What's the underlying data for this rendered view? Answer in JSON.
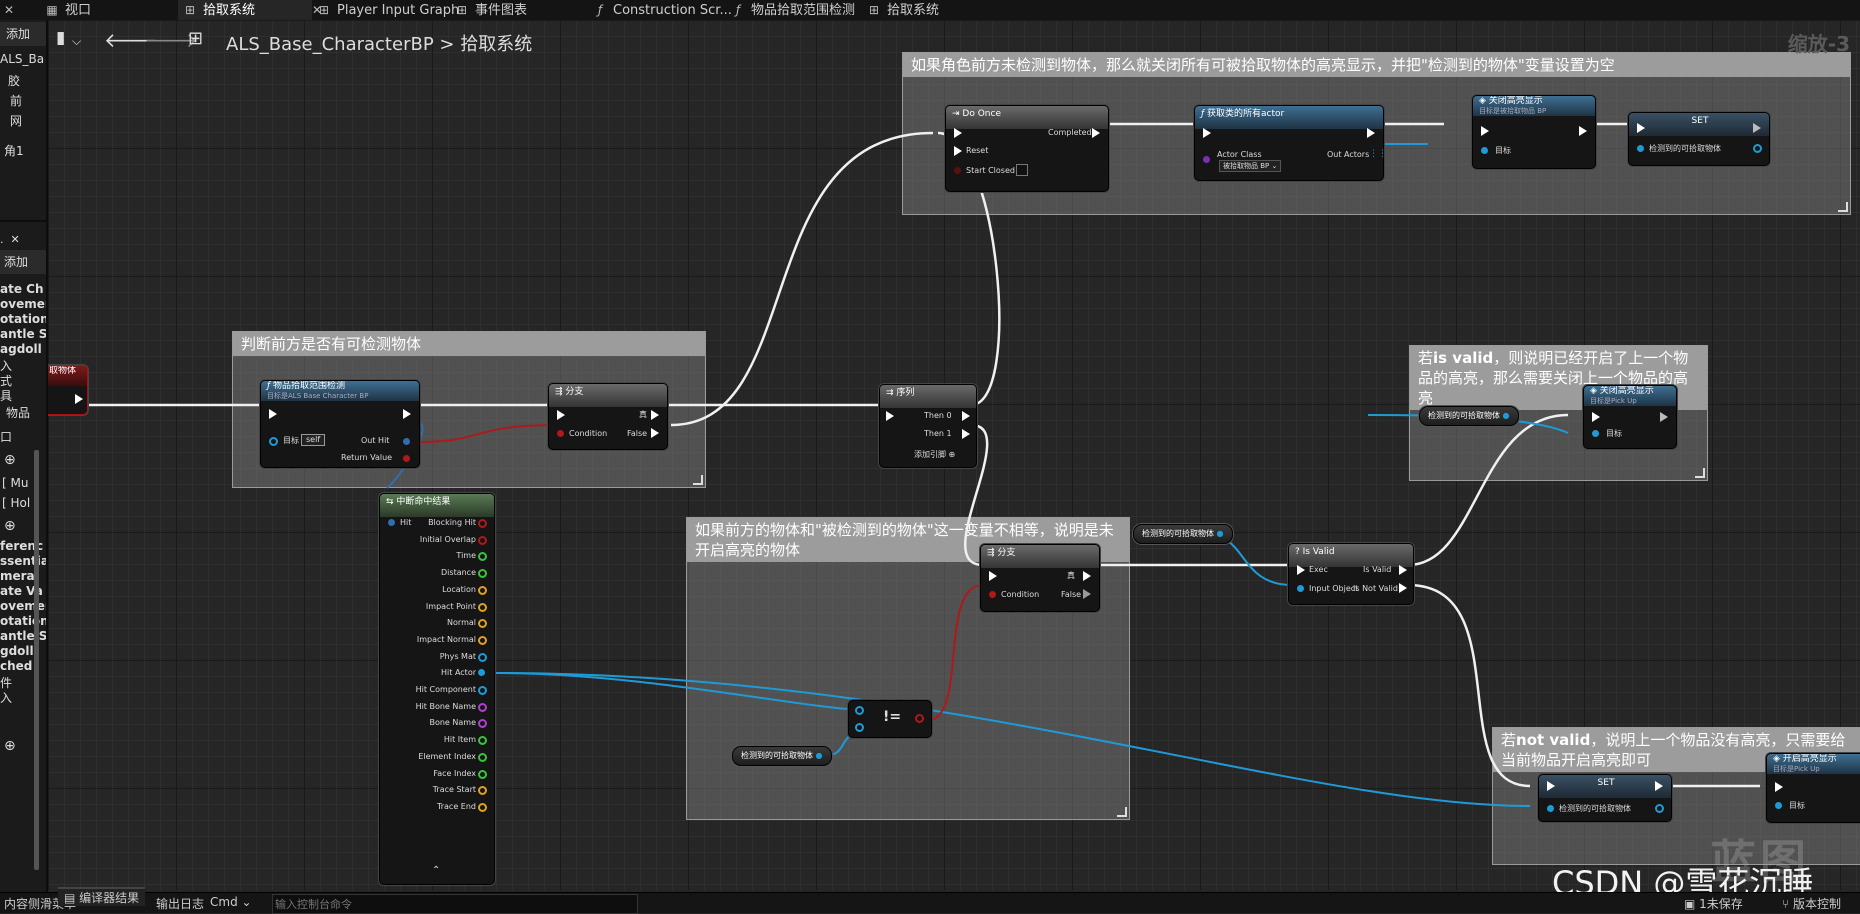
{
  "tabs": [
    {
      "label": "视口",
      "icon": "viewport-grid-icon"
    },
    {
      "label": "拾取系统",
      "icon": "graph-icon",
      "active": true
    },
    {
      "label": "Player Input Graph",
      "icon": "graph-icon"
    },
    {
      "label": "事件图表",
      "icon": "graph-icon"
    },
    {
      "label": "Construction Scr...",
      "icon": "function-icon"
    },
    {
      "label": "物品拾取范围检测",
      "icon": "function-icon"
    },
    {
      "label": "拾取系统",
      "icon": "graph-icon"
    }
  ],
  "left_panel": {
    "add_label_top": "添加",
    "add_label_mid": "添加",
    "items_top": [
      "ALS_Ba",
      "胶",
      "前",
      "网",
      "角1"
    ],
    "items_mid": [
      "取物体",
      "ate Ch",
      "ovemen",
      "otation",
      "antle S",
      "agdoll",
      "入",
      "式",
      "具",
      "物品"
    ],
    "items_low": [
      "口",
      "Mu",
      "Hol",
      "ferenc",
      "ssentia",
      "mera",
      "ate Va",
      "ovemen",
      "otation",
      "antle S",
      "gdoll",
      "ched",
      "件",
      "入"
    ]
  },
  "toolbar": {
    "blueprint": "ALS_Base_CharacterBP",
    "separator": ">",
    "graph": "拾取系统",
    "zoom": "缩放-3"
  },
  "comments": {
    "c1": "如果角色前方未检测到物体，那么就关闭所有可被拾取物体的高亮显示，并把\"检测到的物体\"变量设置为空",
    "c2": "判断前方是否有可检测物体",
    "c3": "如果前方的物体和\"被检测到的物体\"这一变量不相等，说明是未开启高亮的物体",
    "c4a": "若",
    "c4b": "is valid",
    "c4c": "，则说明已经开启了上一个物品的高亮，那么需要关闭上一个物品的高亮",
    "c5a": "若",
    "c5b": "not valid",
    "c5c": "，说明上一个物品没有高亮，只需要给当前物品开启高亮即可"
  },
  "nodes": {
    "event_partial": "取物体",
    "pickup_func": {
      "title": "物品拾取范围检测",
      "sub": "目标是ALS Base Character BP",
      "target": "目标",
      "self": "self",
      "out_hit": "Out Hit",
      "return_value": "Return Value"
    },
    "branch1": {
      "title": "分支",
      "condition": "Condition",
      "true": "真",
      "false": "False"
    },
    "sequence": {
      "title": "序列",
      "then0": "Then 0",
      "then1": "Then 1",
      "add_pin": "添加引脚"
    },
    "do_once": {
      "title": "Do Once",
      "completed": "Completed",
      "reset": "Reset",
      "start_closed": "Start Closed"
    },
    "get_all": {
      "title": "获取类的所有actor",
      "actor_class": "Actor Class",
      "out_actors": "Out Actors",
      "class_value": "被拾取物品 BP"
    },
    "close_hl1": {
      "title": "关闭高亮显示",
      "sub": "目标是被拾取物品 BP",
      "target": "目标"
    },
    "set1": {
      "title": "SET",
      "var": "检测到的可拾取物体"
    },
    "break_hit": {
      "title": "中断命中结果",
      "pins": [
        "Hit",
        "Blocking Hit",
        "Initial Overlap",
        "Time",
        "Distance",
        "Location",
        "Impact Point",
        "Normal",
        "Impact Normal",
        "Phys Mat",
        "Hit Actor",
        "Hit Component",
        "Hit Bone Name",
        "Bone Name",
        "Hit Item",
        "Element Index",
        "Face Index",
        "Trace Start",
        "Trace End"
      ]
    },
    "branch2": {
      "title": "分支",
      "condition": "Condition",
      "true": "真",
      "false": "False"
    },
    "neq": {
      "label": "!="
    },
    "var_get_a": "检测到的可拾取物体",
    "var_get_b": "检测到的可拾取物体",
    "var_get_c": "检测到的可拾取物体",
    "is_valid": {
      "title": "Is Valid",
      "exec": "Exec",
      "input": "Input Object",
      "valid": "Is Valid",
      "not_valid": "Is Not Valid"
    },
    "close_hl2": {
      "title": "关闭高亮显示",
      "sub": "目标是Pick Up",
      "target": "目标"
    },
    "set2": {
      "title": "SET",
      "var": "检测到的可拾取物体"
    },
    "open_hl": {
      "title": "开启高亮显示",
      "sub": "目标是Pick Up",
      "target": "目标"
    }
  },
  "status": {
    "compile_results": "编译器结果",
    "log": "输出日志",
    "content_left": "内容侧滑菜单",
    "cmd": "Cmd",
    "console_placeholder": "输入控制台命令",
    "unsaved": "1未保存",
    "source_control": "版本控制"
  },
  "watermark": {
    "text": "CSDN @雪花沉睡_",
    "logo": "蓝图"
  },
  "colors": {
    "exec": "#ffffff",
    "object": "#1e9bd7",
    "bool": "#b01919",
    "struct": "#2f6fb1"
  }
}
